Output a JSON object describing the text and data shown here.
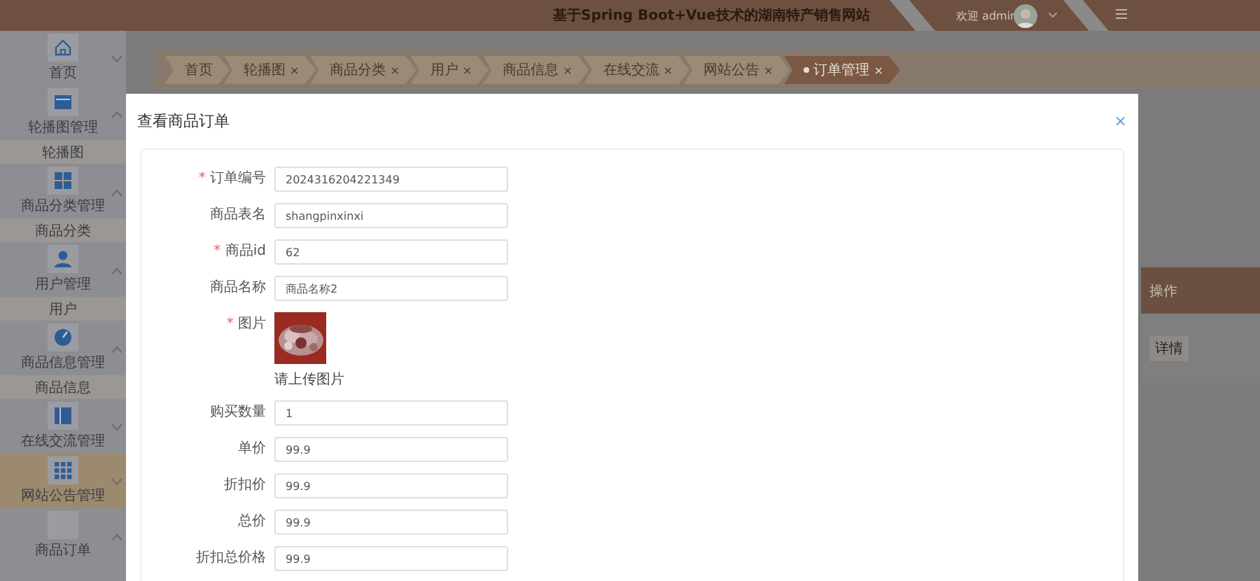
{
  "header": {
    "title": "基于Spring Boot+Vue技术的湖南特产销售网站",
    "welcome": "欢迎 admin"
  },
  "sidebar": {
    "items": [
      {
        "label": "首页",
        "expanded": false,
        "selected": false
      },
      {
        "label": "轮播图管理",
        "expanded": true,
        "selected": false,
        "children": [
          {
            "label": "轮播图"
          }
        ]
      },
      {
        "label": "商品分类管理",
        "expanded": true,
        "selected": false,
        "children": [
          {
            "label": "商品分类"
          }
        ]
      },
      {
        "label": "用户管理",
        "expanded": true,
        "selected": false,
        "children": [
          {
            "label": "用户"
          }
        ]
      },
      {
        "label": "商品信息管理",
        "expanded": true,
        "selected": false,
        "children": [
          {
            "label": "商品信息"
          }
        ]
      },
      {
        "label": "在线交流管理",
        "expanded": false,
        "selected": false
      },
      {
        "label": "网站公告管理",
        "expanded": false,
        "selected": true
      },
      {
        "label": "商品订单",
        "expanded": true,
        "selected": false
      }
    ]
  },
  "tabs": [
    {
      "label": "首页",
      "selected": false
    },
    {
      "label": "轮播图",
      "close": "×",
      "selected": false
    },
    {
      "label": "商品分类",
      "close": "×",
      "selected": false
    },
    {
      "label": "用户",
      "close": "×",
      "selected": false
    },
    {
      "label": "商品信息",
      "close": "×",
      "selected": false
    },
    {
      "label": "在线交流",
      "close": "×",
      "selected": false
    },
    {
      "label": "网站公告",
      "close": "×",
      "selected": false
    },
    {
      "label": "订单管理",
      "close": "×",
      "selected": true
    }
  ],
  "table": {
    "columns": [
      "操作"
    ],
    "rows": [
      {
        "action": "详情"
      }
    ]
  },
  "dialog": {
    "title": "查看商品订单",
    "close": "×",
    "fields": [
      {
        "kind": "input",
        "mark": "*",
        "label": "订单编号",
        "value": "2024316204221349"
      },
      {
        "kind": "input",
        "label": "商品表名",
        "value": "shangpinxinxi"
      },
      {
        "kind": "input",
        "mark": "*",
        "label": "商品id",
        "value": "62"
      },
      {
        "kind": "input",
        "label": "商品名称",
        "value": "商品名称2"
      },
      {
        "mark": "*",
        "label": "图片",
        "hint": "请上传图片"
      },
      {
        "kind": "input",
        "label": "购买数量",
        "value": "1"
      },
      {
        "kind": "input",
        "label": "单价",
        "value": "99.9"
      },
      {
        "kind": "input",
        "label": "折扣价",
        "value": "99.9"
      },
      {
        "kind": "input",
        "label": "总价",
        "value": "99.9"
      },
      {
        "kind": "input",
        "label": "折扣总价格",
        "value": "99.9"
      }
    ]
  }
}
